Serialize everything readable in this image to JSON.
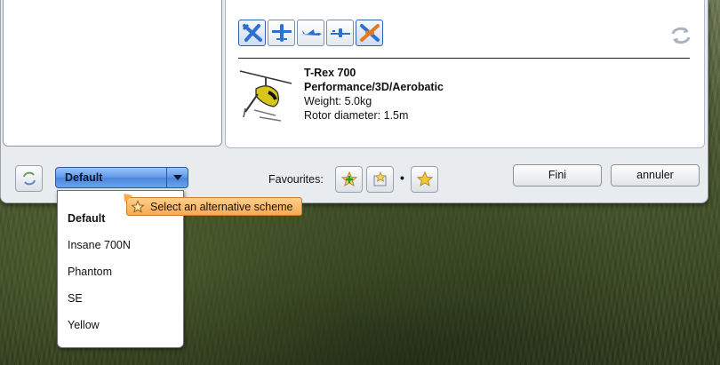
{
  "model": {
    "name": "T-Rex 700",
    "category": "Performance/3D/Aerobatic",
    "weight": "Weight: 5.0kg",
    "rotor": "Rotor diameter: 1.5m"
  },
  "aircraft_types": [
    {
      "icon": "plane-icon",
      "active": true
    },
    {
      "icon": "glider-icon",
      "active": false
    },
    {
      "icon": "jet-icon",
      "active": false
    },
    {
      "icon": "aerobatic-plane-icon",
      "active": false
    },
    {
      "icon": "helicopter-icon",
      "active": true
    }
  ],
  "scheme": {
    "selected": "Default",
    "options": [
      "Default",
      "Insane 700N",
      "Phantom",
      "SE",
      "Yellow"
    ],
    "tooltip": "Select an alternative scheme"
  },
  "favourites": {
    "label": "Favourites:",
    "separator": "•"
  },
  "buttons": {
    "ok": "Fini",
    "cancel": "annuler"
  },
  "colors": {
    "accent": "#5e97e8",
    "tooltip": "#f6aa55",
    "icon_blue": "#2f6fd0"
  }
}
